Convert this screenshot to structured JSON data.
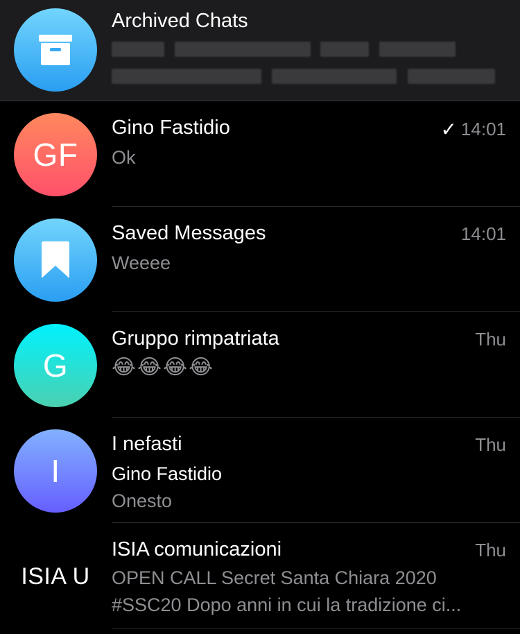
{
  "archived": {
    "title": "Archived Chats",
    "icon": "archive-box-icon"
  },
  "chats": [
    {
      "avatar_text": "GF",
      "name": "Gino Fastidio",
      "time": "14:01",
      "read_check": "✓",
      "preview": "Ok"
    },
    {
      "avatar_icon": "bookmark-icon",
      "name": "Saved Messages",
      "time": "14:01",
      "preview": "Weeee"
    },
    {
      "avatar_text": "G",
      "name": "Gruppo rimpatriata",
      "time": "Thu",
      "preview": "😂😂😂😂"
    },
    {
      "avatar_text": "I",
      "name": "I nefasti",
      "time": "Thu",
      "sender": "Gino Fastidio",
      "preview": "Onesto"
    },
    {
      "avatar_text": "ISIA U",
      "name": "ISIA comunicazioni",
      "time": "Thu",
      "preview_line1": "OPEN CALL Secret Santa Chiara 2020",
      "preview_line2": "#SSC20 Dopo anni in cui la tradizione ci..."
    }
  ],
  "colors": {
    "background": "#000000",
    "archived_bg": "#1c1c1e",
    "secondary_text": "#8e8e93",
    "separator": "#2c2c2e"
  }
}
